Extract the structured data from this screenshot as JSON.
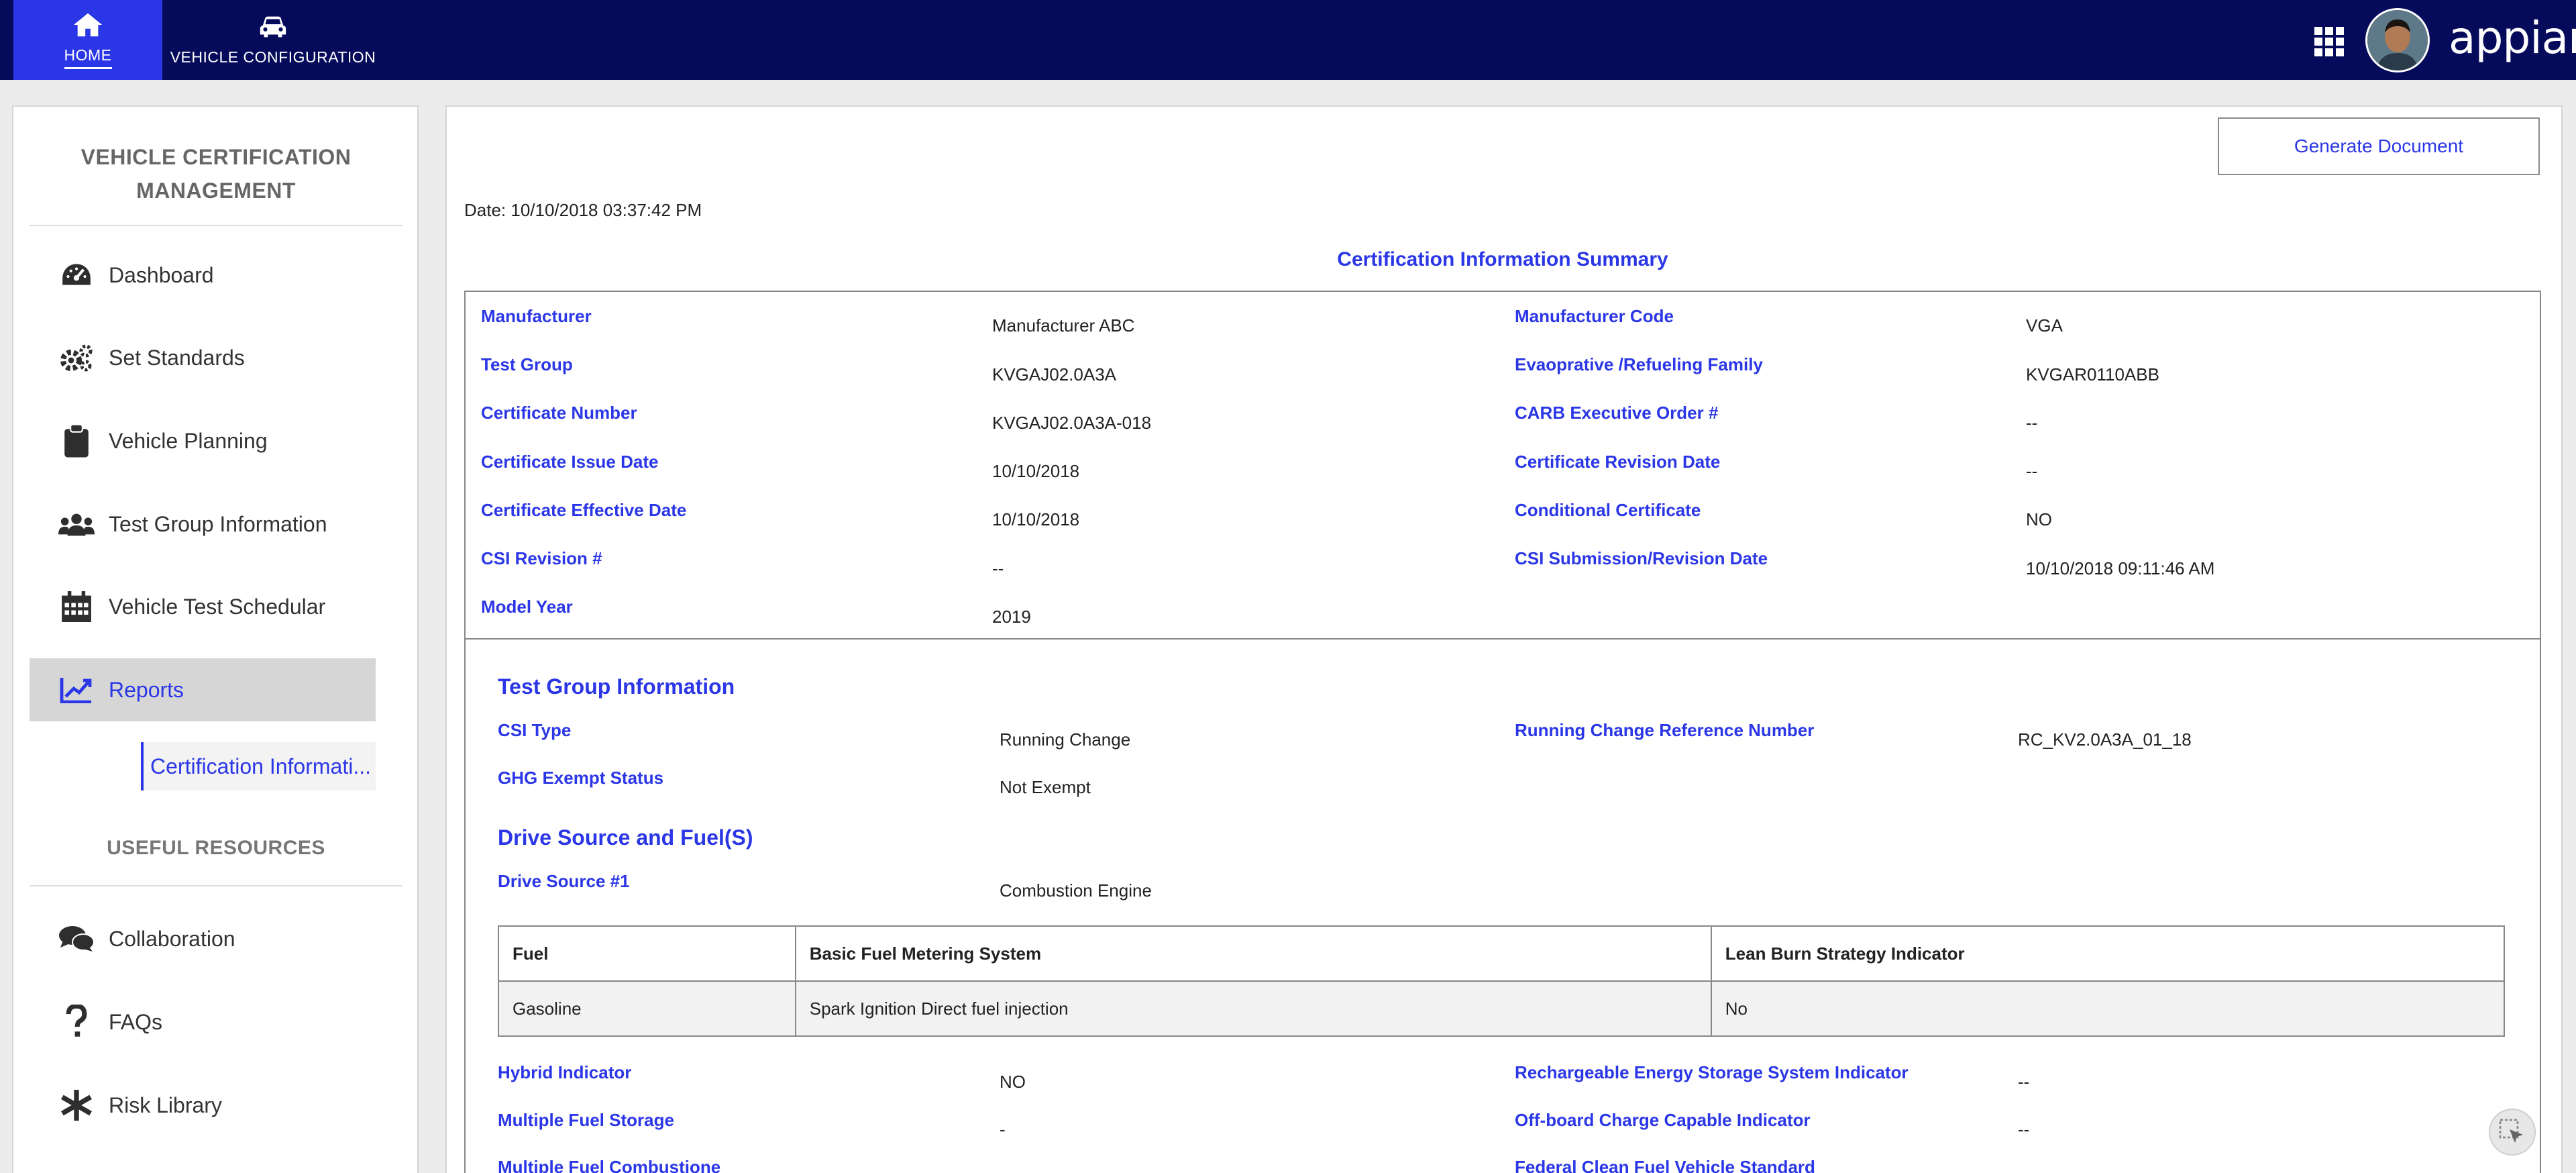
{
  "topbar": {
    "tabs": [
      {
        "label": "HOME",
        "icon": "home-icon"
      },
      {
        "label": "VEHICLE CONFIGURATION",
        "icon": "car-icon"
      }
    ],
    "brand": "appian"
  },
  "sidebar": {
    "title_line1": "VEHICLE CERTIFICATION",
    "title_line2": "MANAGEMENT",
    "items": [
      {
        "label": "Dashboard",
        "icon": "dashboard-gauge-icon"
      },
      {
        "label": "Set Standards",
        "icon": "gears-icon"
      },
      {
        "label": "Vehicle Planning",
        "icon": "clipboard-icon"
      },
      {
        "label": "Test Group Information",
        "icon": "users-group-icon"
      },
      {
        "label": "Vehicle Test Schedular",
        "icon": "calendar-icon"
      },
      {
        "label": "Reports",
        "icon": "line-chart-icon"
      }
    ],
    "sub_item": "Certification Informati...",
    "resources_title": "USEFUL RESOURCES",
    "resources": [
      {
        "label": "Collaboration",
        "icon": "chat-bubbles-icon"
      },
      {
        "label": "FAQs",
        "icon": "question-mark-icon"
      },
      {
        "label": "Risk Library",
        "icon": "asterisk-icon"
      }
    ]
  },
  "main": {
    "generate_button": "Generate Document",
    "date": "Date: 10/10/2018 03:37:42 PM",
    "summary_title": "Certification Information Summary",
    "summary": {
      "left": [
        {
          "label": "Manufacturer",
          "value": "Manufacturer ABC"
        },
        {
          "label": "Test Group",
          "value": "KVGAJ02.0A3A"
        },
        {
          "label": "Certificate Number",
          "value": "KVGAJ02.0A3A-018"
        },
        {
          "label": "Certificate Issue Date",
          "value": "10/10/2018"
        },
        {
          "label": "Certificate Effective Date",
          "value": "10/10/2018"
        },
        {
          "label": "CSI Revision #",
          "value": "--"
        },
        {
          "label": "Model Year",
          "value": "2019"
        }
      ],
      "right": [
        {
          "label": "Manufacturer Code",
          "value": "VGA"
        },
        {
          "label": "Evaoprative /Refueling Family",
          "value": "KVGAR0110ABB"
        },
        {
          "label": "CARB Executive Order #",
          "value": "--"
        },
        {
          "label": "Certificate Revision Date",
          "value": "--"
        },
        {
          "label": "Conditional Certificate",
          "value": "NO"
        },
        {
          "label": "CSI Submission/Revision Date",
          "value": "10/10/2018 09:11:46 AM"
        }
      ]
    },
    "test_group": {
      "heading": "Test Group Information",
      "csi_type_label": "CSI Type",
      "csi_type_value": "Running Change",
      "ghg_label": "GHG Exempt Status",
      "ghg_value": "Not Exempt",
      "rc_label": "Running Change Reference Number",
      "rc_value": "RC_KV2.0A3A_01_18"
    },
    "drive": {
      "heading": "Drive Source and Fuel(S)",
      "source_label": "Drive Source #1",
      "source_value": "Combustion Engine"
    },
    "fuel_table": {
      "headers": [
        "Fuel",
        "Basic Fuel Metering System",
        "Lean Burn Strategy Indicator"
      ],
      "rows": [
        [
          "Gasoline",
          "Spark Ignition Direct fuel injection",
          "No"
        ]
      ]
    },
    "bottom": {
      "hybrid_label": "Hybrid Indicator",
      "hybrid_value": "NO",
      "mfs_label": "Multiple Fuel Storage",
      "mfs_value": "-",
      "mfc_label": "Multiple Fuel Combustione",
      "ress_label": "Rechargeable Energy Storage System Indicator",
      "ress_value": "--",
      "offboard_label": "Off-board Charge Capable Indicator",
      "offboard_value": "--",
      "fcfv_label": "Federal Clean Fuel Vehicle Standard"
    }
  },
  "colors": {
    "topbar": "#060a5a",
    "accent": "#2b37e6",
    "active_item": "#d6d6d6"
  }
}
